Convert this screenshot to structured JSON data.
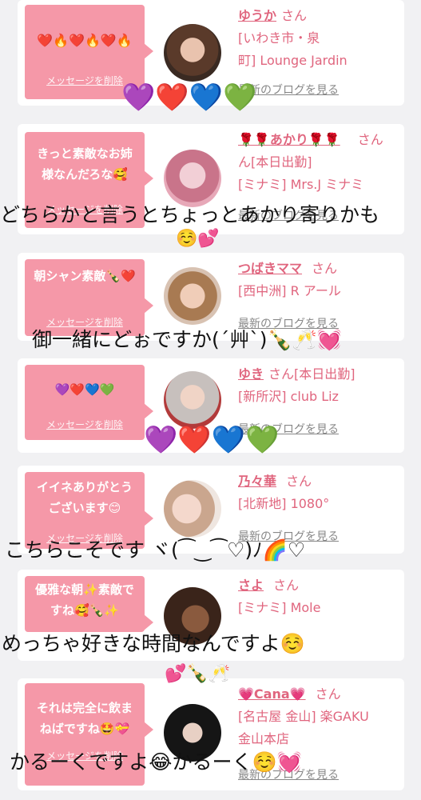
{
  "common": {
    "delete_label": "メッセージを削除",
    "san": "さん",
    "blog_label": "最新のブログを見る"
  },
  "cards": [
    {
      "message": "❤️🔥❤️🔥❤️🔥",
      "name": "ゆうか",
      "shop_lines": [
        "[いわき市・泉",
        "町] Lounge Jardin"
      ]
    },
    {
      "message": "きっと素敵なお姉様なんだろな🥰",
      "name": "🌹🌹あかり🌹🌹",
      "shop_lines": [
        "ん[本日出勤]",
        "[ミナミ] Mrs.J ミナミ"
      ]
    },
    {
      "message": "朝シャン素敵🍾❤️",
      "name": "つばきママ",
      "shop_lines": [
        "[西中洲] R アール"
      ]
    },
    {
      "message": "💜❤️💙💚",
      "name": "ゆき",
      "name_suffix": "さん[本日出勤]",
      "shop_lines": [
        "[新所沢] club Liz"
      ]
    },
    {
      "message": "イイネありがとうございます😊",
      "name": "乃々華",
      "shop_lines": [
        "[北新地] 1080°"
      ]
    },
    {
      "message": "優雅な朝✨素敵ですね🥰🍾✨",
      "name": "さよ",
      "shop_lines": [
        "[ミナミ] Mole"
      ]
    },
    {
      "message": "それは完全に飲まねばですね🤩💝",
      "name": "💗Cana💗",
      "shop_lines": [
        "[名古屋 金山] 楽GAKU",
        "金山本店"
      ]
    }
  ],
  "overlays": [
    "💜❤️💙💚",
    "どちらかと言うとちょっとあかり寄りかも",
    "☺️💕",
    "御一緒にどぉですか(´艸`)🍾🥂💓",
    "💜❤️💙💚",
    "こちらこそです ヾ(⁀‿⁀♡)ﾉ🌈♡",
    "めっちゃ好きな時間なんですよ☺️",
    "💕🍾🥂",
    "かるーくですよ😂かるーく☺️💓"
  ]
}
